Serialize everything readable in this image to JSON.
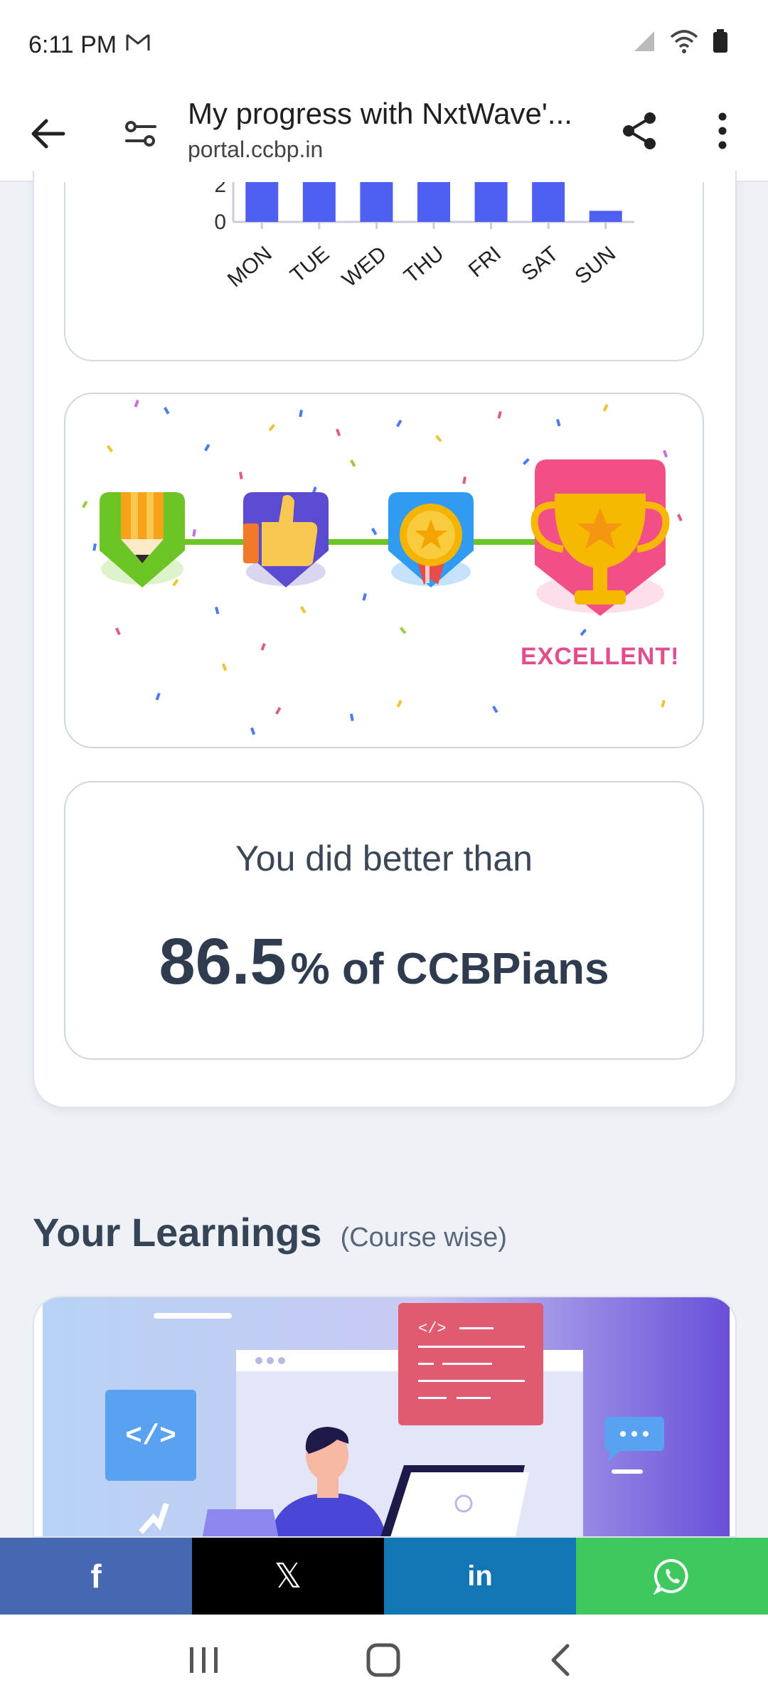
{
  "status_bar": {
    "time": "6:11 PM"
  },
  "browser": {
    "title": "My progress with NxtWave'...",
    "url": "portal.ccbp.in"
  },
  "chart_data": {
    "type": "bar",
    "categories": [
      "MON",
      "TUE",
      "WED",
      "THU",
      "FRI",
      "SAT",
      "SUN"
    ],
    "values": [
      3.0,
      3.0,
      3.0,
      3.0,
      3.0,
      3.0,
      0.6
    ],
    "ytick_labels": [
      "0",
      "2"
    ],
    "bar_color": "#4f5ff0"
  },
  "badges": {
    "label": "EXCELLENT!",
    "connector_color": "#6cc524",
    "label_color": "#e24d8d"
  },
  "comparison": {
    "line1": "You did better than",
    "percent": "86.5",
    "suffix": "% of CCBPians"
  },
  "learnings": {
    "title": "Your Learnings",
    "subtitle": "(Course wise)"
  },
  "share_bar": {
    "facebook_label": "f",
    "x_label": "𝕏",
    "linkedin_label": "in",
    "colors": {
      "facebook": "#4668b0",
      "x": "#000000",
      "linkedin": "#1276b4",
      "whatsapp": "#3ec95e"
    }
  }
}
